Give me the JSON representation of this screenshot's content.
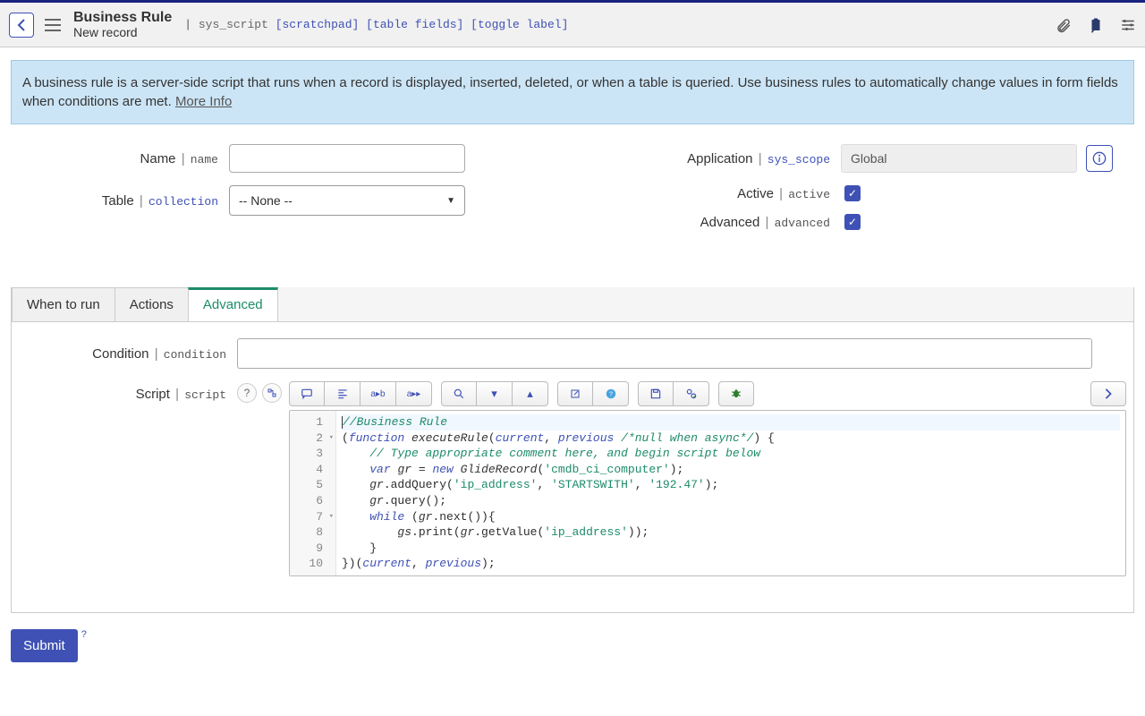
{
  "header": {
    "title": "Business Rule",
    "subtitle": "New record",
    "sys_table": "sys_script",
    "links": [
      "[scratchpad]",
      "[table fields]",
      "[toggle label]"
    ]
  },
  "banner": {
    "text": "A business rule is a server-side script that runs when a record is displayed, inserted, deleted, or when a table is queried. Use business rules to automatically change values in form fields when conditions are met. ",
    "more": "More Info"
  },
  "fields": {
    "name": {
      "label": "Name",
      "tech": "name",
      "value": ""
    },
    "table": {
      "label": "Table",
      "tech": "collection",
      "value": "-- None --"
    },
    "application": {
      "label": "Application",
      "tech": "sys_scope",
      "value": "Global"
    },
    "active": {
      "label": "Active",
      "tech": "active",
      "checked": true
    },
    "advanced": {
      "label": "Advanced",
      "tech": "advanced",
      "checked": true
    }
  },
  "tabs": {
    "items": [
      "When to run",
      "Actions",
      "Advanced"
    ],
    "activeIndex": 2
  },
  "adv": {
    "condition": {
      "label": "Condition",
      "tech": "condition",
      "value": ""
    },
    "script": {
      "label": "Script",
      "tech": "script"
    }
  },
  "editor": {
    "lines": [
      {
        "n": 1,
        "raw": "//Business Rule"
      },
      {
        "n": 2,
        "raw": "(function executeRule(current, previous /*null when async*/) {"
      },
      {
        "n": 3,
        "raw": "    // Type appropriate comment here, and begin script below"
      },
      {
        "n": 4,
        "raw": "    var gr = new GlideRecord('cmdb_ci_computer');"
      },
      {
        "n": 5,
        "raw": "    gr.addQuery('ip_address', 'STARTSWITH', '192.47');"
      },
      {
        "n": 6,
        "raw": "    gr.query();"
      },
      {
        "n": 7,
        "raw": "    while (gr.next()){"
      },
      {
        "n": 8,
        "raw": "        gs.print(gr.getValue('ip_address'));"
      },
      {
        "n": 9,
        "raw": "    }"
      },
      {
        "n": 10,
        "raw": "})(current, previous);"
      }
    ]
  },
  "submit": {
    "label": "Submit",
    "help": "?"
  }
}
